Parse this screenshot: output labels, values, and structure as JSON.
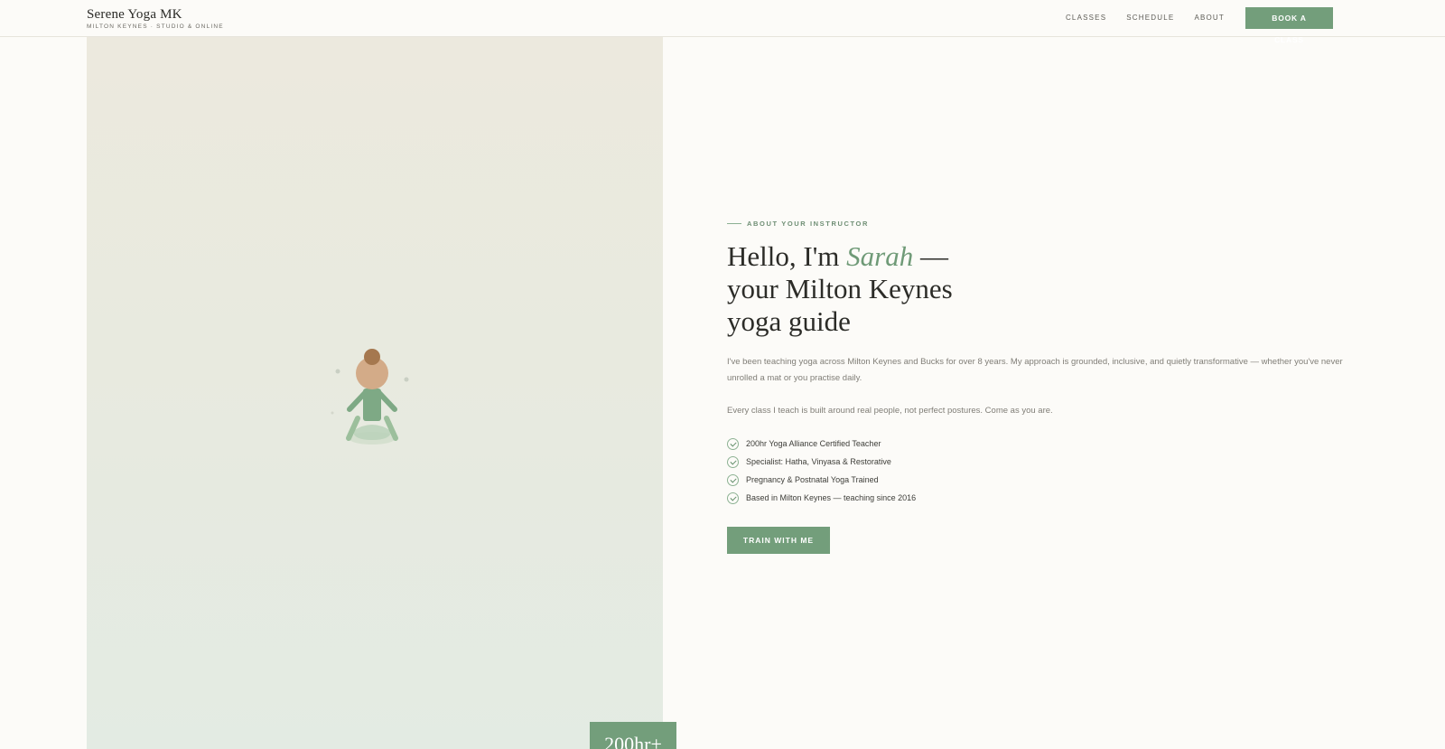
{
  "header": {
    "brand": "Serene Yoga MK",
    "brand_sub": "MILTON KEYNES · STUDIO & ONLINE",
    "nav": [
      "CLASSES",
      "SCHEDULE",
      "ABOUT"
    ],
    "book_button": "BOOK A CLASS"
  },
  "hero": {
    "eyebrow": "ABOUT YOUR INSTRUCTOR",
    "title_pre": "Hello, I'm ",
    "title_name": "Sarah",
    "title_line1_end": " —",
    "title_line2": "your Milton Keynes",
    "title_line3": "yoga guide",
    "para1": "I've been teaching yoga across Milton Keynes and Bucks for over 8 years. My approach is grounded, inclusive, and quietly transformative — whether you've never unrolled a mat or you practise daily.",
    "para2": "Every class I teach is built around real people, not perfect postures. Come as you are.",
    "credentials": [
      "200hr Yoga Alliance Certified Teacher",
      "Specialist: Hatha, Vinyasa & Restorative",
      "Pregnancy & Postnatal Yoga Trained",
      "Based in Milton Keynes — teaching since 2016"
    ],
    "cta": "TRAIN WITH ME",
    "badge": "200hr+"
  },
  "colors": {
    "accent": "#739e7b",
    "background": "#fcfbf8"
  },
  "icons": {
    "check": "check-circle-icon",
    "figure": "meditation-figure-illustration"
  }
}
